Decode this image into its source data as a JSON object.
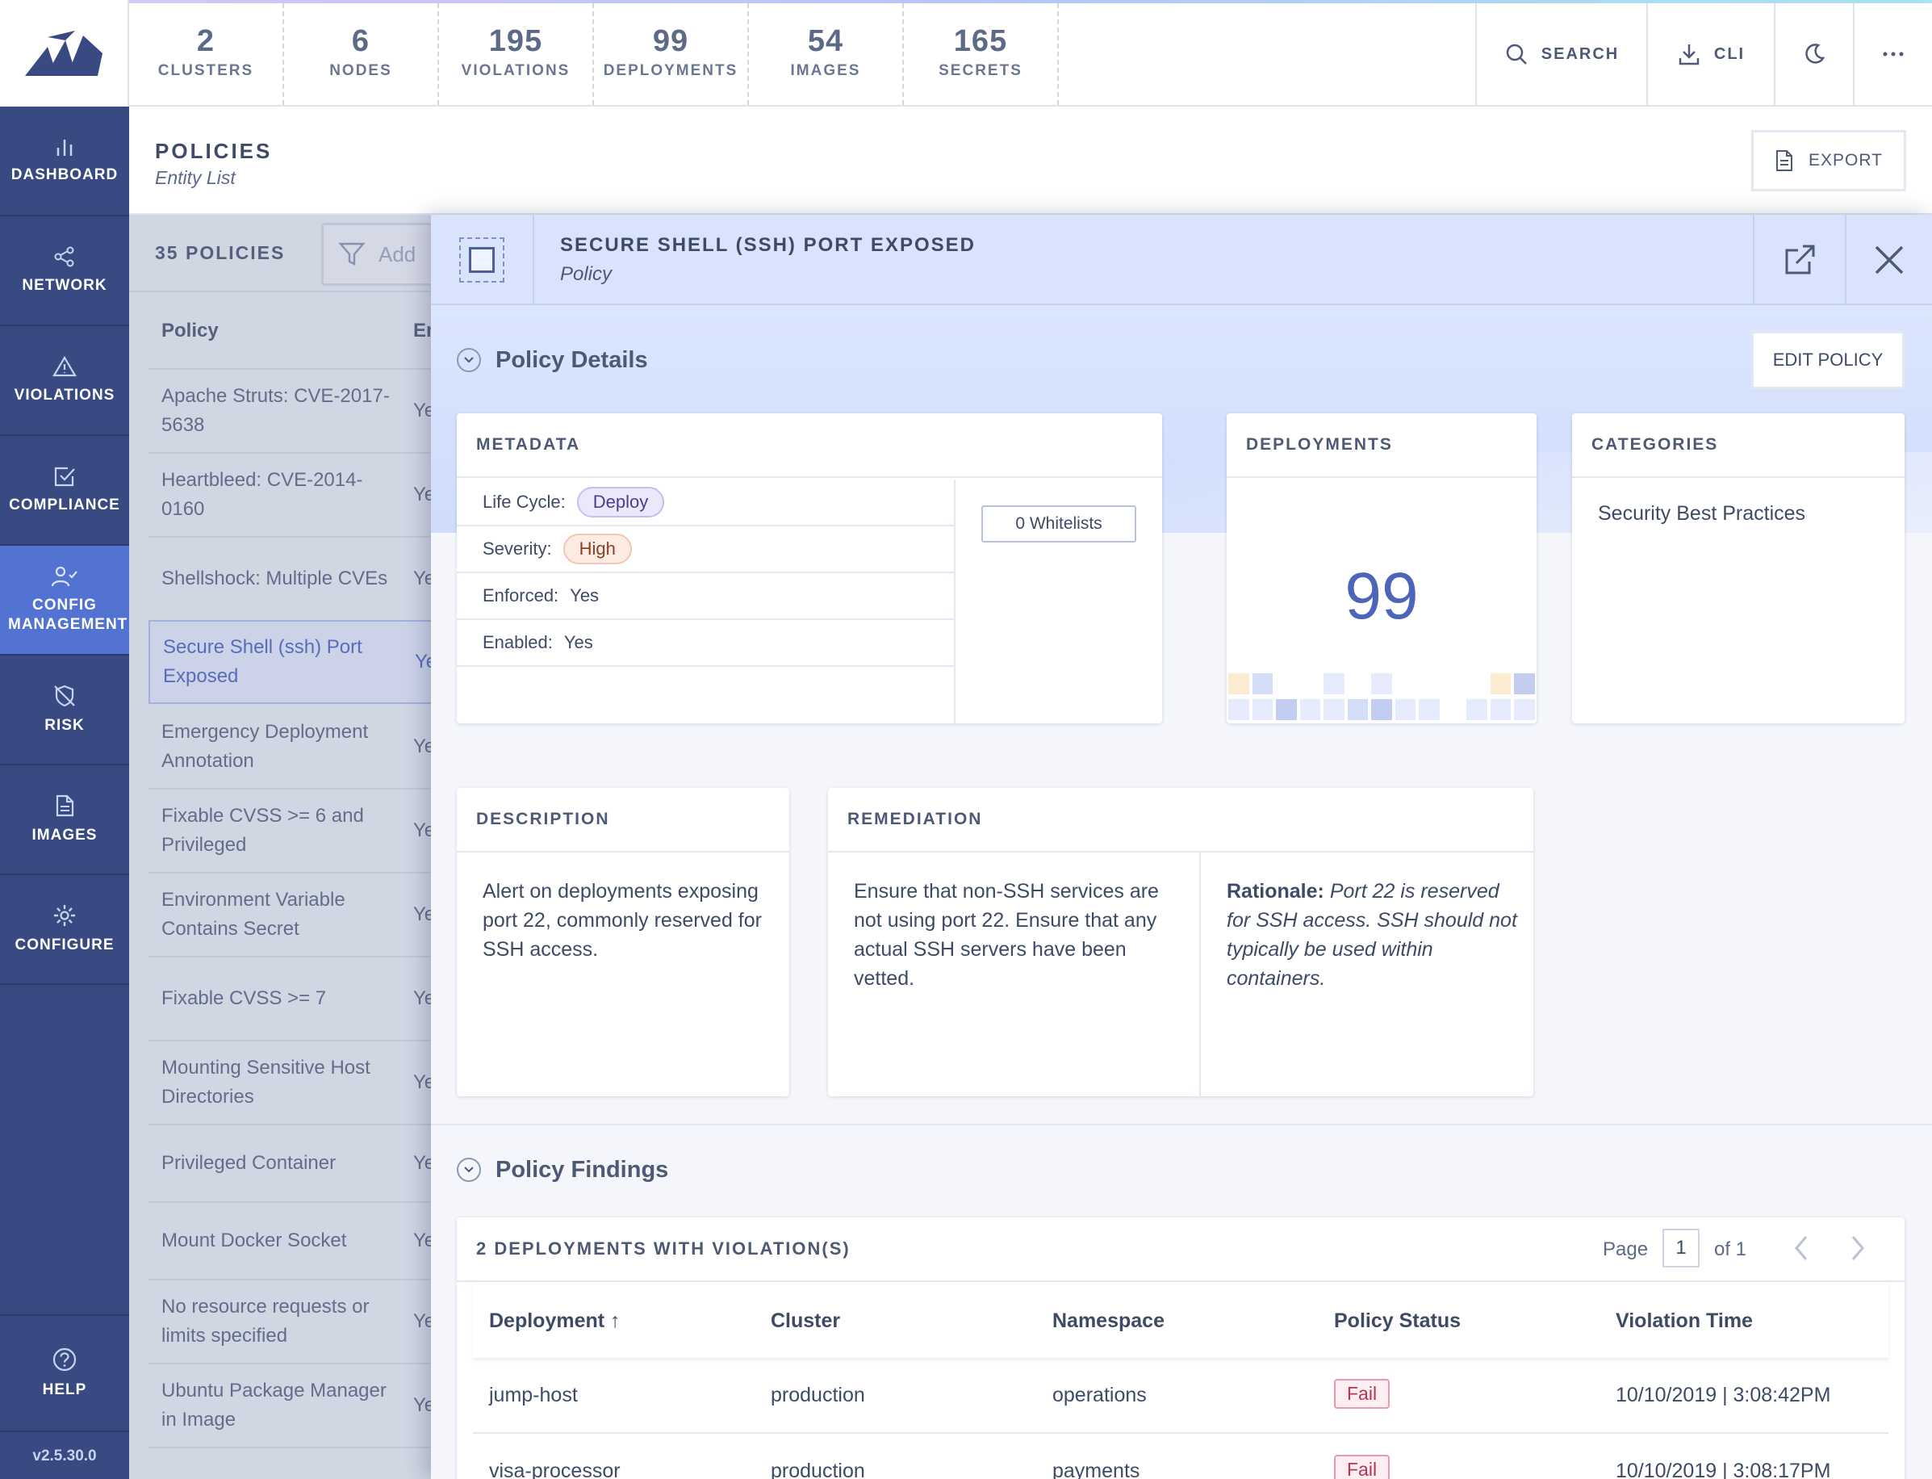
{
  "topbar": {
    "stats": [
      {
        "value": "2",
        "label": "CLUSTERS"
      },
      {
        "value": "6",
        "label": "NODES"
      },
      {
        "value": "195",
        "label": "VIOLATIONS"
      },
      {
        "value": "99",
        "label": "DEPLOYMENTS"
      },
      {
        "value": "54",
        "label": "IMAGES"
      },
      {
        "value": "165",
        "label": "SECRETS"
      }
    ],
    "search_label": "SEARCH",
    "cli_label": "CLI"
  },
  "nav": {
    "items": [
      {
        "label": "DASHBOARD"
      },
      {
        "label": "NETWORK"
      },
      {
        "label": "VIOLATIONS"
      },
      {
        "label": "COMPLIANCE"
      },
      {
        "label": "CONFIG MANAGEMENT"
      },
      {
        "label": "RISK"
      },
      {
        "label": "IMAGES"
      },
      {
        "label": "CONFIGURE"
      }
    ],
    "help_label": "HELP",
    "version": "v2.5.30.0"
  },
  "page": {
    "title": "POLICIES",
    "subtitle": "Entity List",
    "export_label": "EXPORT"
  },
  "list": {
    "count_label": "35 POLICIES",
    "filter_placeholder": "Add",
    "col_policy": "Policy",
    "col_enforced": "En",
    "rows": [
      {
        "name": "Apache Struts: CVE-2017-5638",
        "enforced": "Ye"
      },
      {
        "name": "Heartbleed: CVE-2014-0160",
        "enforced": "Ye"
      },
      {
        "name": "Shellshock: Multiple CVEs",
        "enforced": "Ye"
      },
      {
        "name": "Secure Shell (ssh) Port Exposed",
        "enforced": "Ye"
      },
      {
        "name": "Emergency Deployment Annotation",
        "enforced": "Ye"
      },
      {
        "name": "Fixable CVSS >= 6 and Privileged",
        "enforced": "Ye"
      },
      {
        "name": "Environment Variable Contains Secret",
        "enforced": "Ye"
      },
      {
        "name": "Fixable CVSS >= 7",
        "enforced": "Ye"
      },
      {
        "name": "Mounting Sensitive Host Directories",
        "enforced": "Ye"
      },
      {
        "name": "Privileged Container",
        "enforced": "Ye"
      },
      {
        "name": "Mount Docker Socket",
        "enforced": "Ye"
      },
      {
        "name": "No resource requests or limits specified",
        "enforced": "Ye"
      },
      {
        "name": "Ubuntu Package Manager in Image",
        "enforced": "Ye"
      }
    ]
  },
  "panel": {
    "title": "SECURE SHELL (SSH) PORT EXPOSED",
    "subtitle": "Policy",
    "details_heading": "Policy Details",
    "edit_label": "EDIT POLICY",
    "metadata": {
      "title": "METADATA",
      "lifecycle_label": "Life Cycle:",
      "lifecycle_value": "Deploy",
      "severity_label": "Severity:",
      "severity_value": "High",
      "enforced_label": "Enforced:",
      "enforced_value": "Yes",
      "enabled_label": "Enabled:",
      "enabled_value": "Yes",
      "whitelists_label": "0 Whitelists"
    },
    "deployments": {
      "title": "DEPLOYMENTS",
      "count": "99"
    },
    "categories": {
      "title": "CATEGORIES",
      "value": "Security Best Practices"
    },
    "description": {
      "title": "DESCRIPTION",
      "text": "Alert on deployments exposing port 22, commonly reserved for SSH access."
    },
    "remediation": {
      "title": "REMEDIATION",
      "text": "Ensure that non-SSH services are not using port 22. Ensure that any actual SSH servers have been vetted.",
      "rationale_label": "Rationale:",
      "rationale_text": "Port 22 is reserved for SSH access. SSH should not typically be used within containers."
    },
    "findings": {
      "heading": "Policy Findings",
      "table_title": "2 DEPLOYMENTS WITH VIOLATION(S)",
      "page_label": "Page",
      "page_value": "1",
      "of_label": "of 1",
      "columns": [
        "Deployment",
        "Cluster",
        "Namespace",
        "Policy Status",
        "Violation Time"
      ],
      "rows": [
        {
          "deployment": "jump-host",
          "cluster": "production",
          "namespace": "operations",
          "status": "Fail",
          "time": "10/10/2019 | 3:08:42PM"
        },
        {
          "deployment": "visa-processor",
          "cluster": "production",
          "namespace": "payments",
          "status": "Fail",
          "time": "10/10/2019 | 3:08:17PM"
        }
      ]
    }
  },
  "colors": {
    "nav_bg": "#394a82",
    "nav_active": "#5373d3",
    "panel_header": "#d9e4fc",
    "accent": "#4f6bc0",
    "fail": "#b83550"
  }
}
